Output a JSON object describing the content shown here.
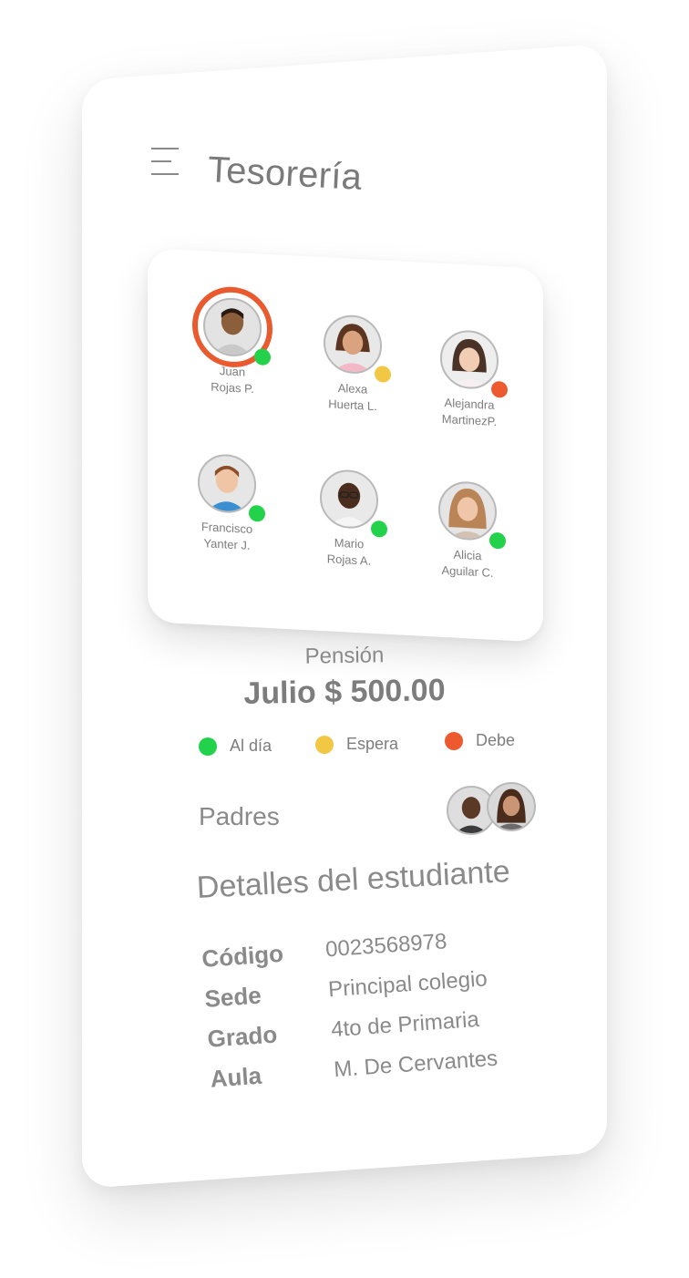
{
  "header": {
    "title": "Tesorería",
    "menu_icon": "hamburger-menu-icon"
  },
  "students": [
    {
      "first": "Juan",
      "last": "Rojas P.",
      "status": "al_dia",
      "selected": true
    },
    {
      "first": "Alexa",
      "last": "Huerta L.",
      "status": "espera",
      "selected": false
    },
    {
      "first": "Alejandra",
      "last": "MartinezP.",
      "status": "debe",
      "selected": false
    },
    {
      "first": "Francisco",
      "last": "Yanter J.",
      "status": "al_dia",
      "selected": false
    },
    {
      "first": "Mario",
      "last": "Rojas A.",
      "status": "al_dia",
      "selected": false
    },
    {
      "first": "Alicia",
      "last": "Aguilar C.",
      "status": "al_dia",
      "selected": false
    }
  ],
  "pension": {
    "label": "Pensión",
    "amount": "Julio $ 500.00"
  },
  "legend": [
    {
      "key": "al_dia",
      "label": "Al día",
      "color": "#22d24a"
    },
    {
      "key": "espera",
      "label": "Espera",
      "color": "#f2c744"
    },
    {
      "key": "debe",
      "label": "Debe",
      "color": "#ee5a30"
    }
  ],
  "parents": {
    "label": "Padres",
    "avatars": [
      "parent-father-avatar",
      "parent-mother-avatar"
    ]
  },
  "details": {
    "title": "Detalles del estudiante",
    "rows": [
      {
        "label": "Código",
        "value": "0023568978"
      },
      {
        "label": "Sede",
        "value": "Principal colegio"
      },
      {
        "label": "Grado",
        "value": "4to de Primaria"
      },
      {
        "label": "Aula",
        "value": "M. De Cervantes"
      }
    ]
  },
  "colors": {
    "accent": "#ea5a2f",
    "text": "#7d7d7d"
  }
}
